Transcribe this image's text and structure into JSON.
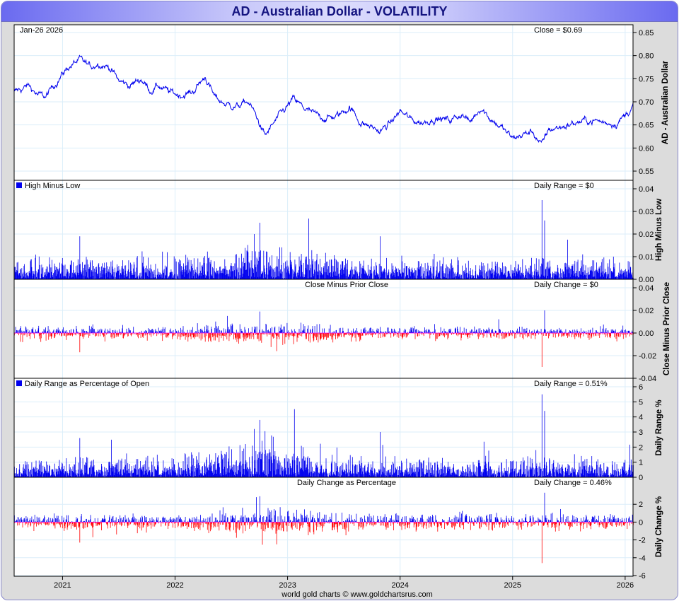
{
  "title": "AD  -  Australian Dollar - VOLATILITY",
  "footer": "world gold charts © www.goldchartsrus.com",
  "colors": {
    "price": "#0000ee",
    "up": "#0000ee",
    "down": "#ff0000",
    "grid": "#dbeefa",
    "zero": "#ff00ff"
  },
  "chart_data": [
    {
      "type": "line",
      "id": "price",
      "date_label": "Jan-26  2026",
      "readout": "Close = $0.69",
      "ylabel": "AD  -  Australian Dollar",
      "ylim": [
        0.55,
        0.85
      ],
      "yticks": [
        "0.85",
        "0.80",
        "0.75",
        "0.70",
        "0.65",
        "0.60",
        "0.55"
      ],
      "x": [
        2020.57,
        2020.7,
        2020.78,
        2020.85,
        2020.95,
        2021.05,
        2021.15,
        2021.25,
        2021.32,
        2021.42,
        2021.5,
        2021.6,
        2021.7,
        2021.78,
        2021.85,
        2021.95,
        2022.05,
        2022.15,
        2022.27,
        2022.35,
        2022.45,
        2022.55,
        2022.65,
        2022.72,
        2022.8,
        2022.9,
        2023.05,
        2023.15,
        2023.25,
        2023.35,
        2023.45,
        2023.55,
        2023.65,
        2023.75,
        2023.82,
        2023.92,
        2024.0,
        2024.1,
        2024.2,
        2024.3,
        2024.45,
        2024.55,
        2024.62,
        2024.72,
        2024.8,
        2024.9,
        2025.0,
        2025.1,
        2025.18,
        2025.26,
        2025.32,
        2025.42,
        2025.52,
        2025.62,
        2025.72,
        2025.82,
        2025.92,
        2026.0,
        2026.07
      ],
      "y": [
        0.72,
        0.735,
        0.715,
        0.71,
        0.745,
        0.775,
        0.79,
        0.775,
        0.785,
        0.775,
        0.745,
        0.735,
        0.75,
        0.725,
        0.735,
        0.72,
        0.715,
        0.72,
        0.755,
        0.71,
        0.695,
        0.69,
        0.7,
        0.67,
        0.625,
        0.66,
        0.705,
        0.685,
        0.67,
        0.665,
        0.67,
        0.69,
        0.655,
        0.645,
        0.635,
        0.655,
        0.68,
        0.66,
        0.655,
        0.665,
        0.66,
        0.675,
        0.655,
        0.69,
        0.665,
        0.645,
        0.62,
        0.63,
        0.635,
        0.605,
        0.64,
        0.645,
        0.652,
        0.658,
        0.66,
        0.655,
        0.655,
        0.67,
        0.693
      ]
    },
    {
      "type": "bar",
      "id": "hl",
      "legend": "High Minus Low",
      "readout": "Daily Range = $0",
      "ylabel": "High Minus Low",
      "ylim": [
        0,
        0.04
      ],
      "yticks": [
        "0.04",
        "0.03",
        "0.02",
        "0.01",
        "0.00"
      ],
      "typical": 0.006,
      "spikes": [
        {
          "x": 2021.15,
          "y": 0.019
        },
        {
          "x": 2022.75,
          "y": 0.025
        },
        {
          "x": 2022.7,
          "y": 0.02
        },
        {
          "x": 2023.82,
          "y": 0.019
        },
        {
          "x": 2025.26,
          "y": 0.035
        },
        {
          "x": 2025.28,
          "y": 0.026
        }
      ]
    },
    {
      "type": "bar",
      "id": "chg",
      "title": "Close Minus Prior Close",
      "readout": "Daily Change = $0",
      "ylabel": "Close Minus Prior Close",
      "ylim": [
        -0.04,
        0.04
      ],
      "yticks": [
        "0.04",
        "0.02",
        "0.00",
        "-0.02",
        "-0.04"
      ],
      "typical": 0.004,
      "spikes": [
        {
          "x": 2022.75,
          "y": 0.019
        },
        {
          "x": 2022.9,
          "y": -0.016
        },
        {
          "x": 2021.15,
          "y": -0.017
        },
        {
          "x": 2025.26,
          "y": -0.03
        },
        {
          "x": 2025.28,
          "y": 0.02
        }
      ]
    },
    {
      "type": "bar",
      "id": "hlpct",
      "legend": "Daily Range as Percentage of Open",
      "readout": "Daily Range = 0.51%",
      "ylabel": "Daily Range %",
      "ylim": [
        0,
        6
      ],
      "yticks": [
        "6",
        "5",
        "4",
        "3",
        "2",
        "1",
        "0"
      ],
      "typical": 0.85,
      "spikes": [
        {
          "x": 2021.15,
          "y": 2.6
        },
        {
          "x": 2022.75,
          "y": 3.8
        },
        {
          "x": 2022.7,
          "y": 3.2
        },
        {
          "x": 2023.82,
          "y": 3.0
        },
        {
          "x": 2025.26,
          "y": 5.5
        },
        {
          "x": 2025.28,
          "y": 4.4
        }
      ]
    },
    {
      "type": "bar",
      "id": "chgpct",
      "title": "Daily Change as Percentage",
      "readout": "Daily Change = 0.46%",
      "ylabel": "Daily Change %",
      "ylim": [
        -6,
        4
      ],
      "yticks": [
        "2",
        "0",
        "-2",
        "-4",
        "-6"
      ],
      "typical": 0.6,
      "spikes": [
        {
          "x": 2022.75,
          "y": 2.9
        },
        {
          "x": 2022.72,
          "y": 2.8
        },
        {
          "x": 2022.9,
          "y": -2.5
        },
        {
          "x": 2021.15,
          "y": -2.3
        },
        {
          "x": 2025.26,
          "y": -4.6
        },
        {
          "x": 2025.28,
          "y": 3.3
        }
      ]
    }
  ],
  "xaxis": {
    "min": 2020.57,
    "max": 2026.07,
    "ticks": [
      "2021",
      "2022",
      "2023",
      "2024",
      "2025",
      "2026"
    ]
  }
}
